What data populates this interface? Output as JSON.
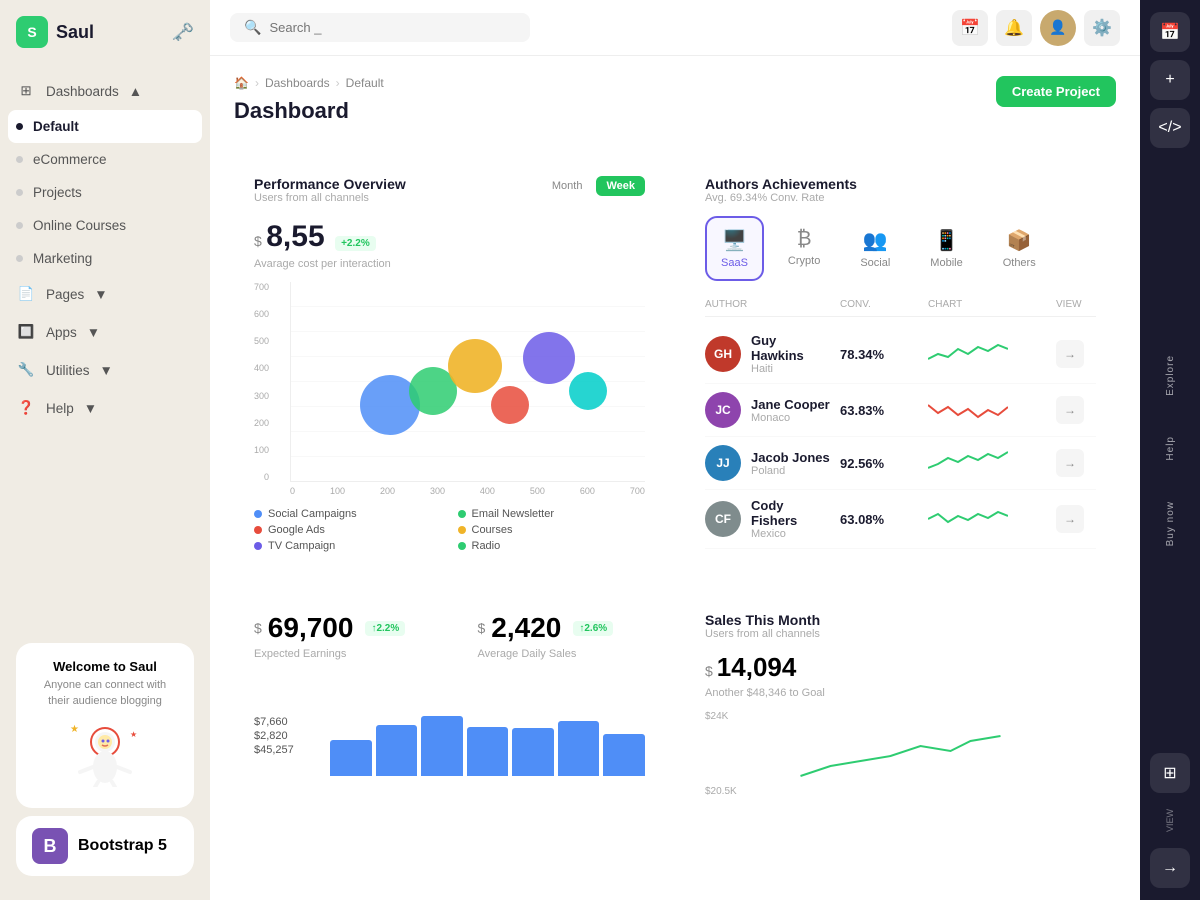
{
  "app": {
    "name": "Saul",
    "logo_letter": "S"
  },
  "topbar": {
    "search_placeholder": "Search _",
    "create_button": "Create Project"
  },
  "sidebar": {
    "nav_items": [
      {
        "id": "dashboards",
        "label": "Dashboards",
        "type": "section",
        "has_chevron": true,
        "icon": "grid"
      },
      {
        "id": "default",
        "label": "Default",
        "type": "sub",
        "active": true
      },
      {
        "id": "ecommerce",
        "label": "eCommerce",
        "type": "sub"
      },
      {
        "id": "projects",
        "label": "Projects",
        "type": "sub"
      },
      {
        "id": "online-courses",
        "label": "Online Courses",
        "type": "sub"
      },
      {
        "id": "marketing",
        "label": "Marketing",
        "type": "sub"
      },
      {
        "id": "pages",
        "label": "Pages",
        "type": "section",
        "has_chevron": true,
        "icon": "file"
      },
      {
        "id": "apps",
        "label": "Apps",
        "type": "section",
        "has_chevron": true,
        "icon": "apps"
      },
      {
        "id": "utilities",
        "label": "Utilities",
        "type": "section",
        "has_chevron": true,
        "icon": "tool"
      },
      {
        "id": "help",
        "label": "Help",
        "type": "section",
        "has_chevron": true,
        "icon": "help"
      }
    ],
    "welcome": {
      "title": "Welcome to Saul",
      "subtitle": "Anyone can connect with their audience blogging"
    }
  },
  "breadcrumb": {
    "home": "🏠",
    "dashboards": "Dashboards",
    "current": "Default"
  },
  "page_title": "Dashboard",
  "performance": {
    "title": "Performance Overview",
    "subtitle": "Users from all channels",
    "tabs": [
      "Month",
      "Week"
    ],
    "active_tab": "Month",
    "metric": "8,55",
    "metric_currency": "$",
    "metric_change": "+2.2%",
    "metric_label": "Avarage cost per interaction",
    "y_axis": [
      "700",
      "600",
      "500",
      "400",
      "300",
      "200",
      "100",
      "0"
    ],
    "x_axis": [
      "0",
      "100",
      "200",
      "300",
      "400",
      "500",
      "600",
      "700"
    ],
    "bubbles": [
      {
        "x": 28,
        "y": 62,
        "size": 60,
        "color": "#4f8ef7"
      },
      {
        "x": 40,
        "y": 55,
        "size": 48,
        "color": "#2ecc71"
      },
      {
        "x": 52,
        "y": 45,
        "size": 54,
        "color": "#f0b429"
      },
      {
        "x": 62,
        "y": 62,
        "size": 38,
        "color": "#e74c3c"
      },
      {
        "x": 73,
        "y": 52,
        "size": 50,
        "color": "#6c5ce7"
      },
      {
        "x": 83,
        "y": 58,
        "size": 38,
        "color": "#00cec9"
      }
    ],
    "legend": [
      {
        "label": "Social Campaigns",
        "color": "#4f8ef7"
      },
      {
        "label": "Email Newsletter",
        "color": "#2ecc71"
      },
      {
        "label": "Google Ads",
        "color": "#e74c3c"
      },
      {
        "label": "Courses",
        "color": "#f0b429"
      },
      {
        "label": "TV Campaign",
        "color": "#6c5ce7"
      },
      {
        "label": "Radio",
        "color": "#2ecc71"
      }
    ]
  },
  "authors": {
    "title": "Authors Achievements",
    "subtitle": "Avg. 69.34% Conv. Rate",
    "categories": [
      {
        "id": "saas",
        "label": "SaaS",
        "icon": "🖥️",
        "active": true
      },
      {
        "id": "crypto",
        "label": "Crypto",
        "icon": "₿"
      },
      {
        "id": "social",
        "label": "Social",
        "icon": "👥"
      },
      {
        "id": "mobile",
        "label": "Mobile",
        "icon": "📱"
      },
      {
        "id": "others",
        "label": "Others",
        "icon": "📦"
      }
    ],
    "table_headers": [
      "AUTHOR",
      "CONV.",
      "CHART",
      "VIEW"
    ],
    "rows": [
      {
        "name": "Guy Hawkins",
        "country": "Haiti",
        "conv": "78.34%",
        "sparkline_color": "#2ecc71",
        "avatar_bg": "#c0392b"
      },
      {
        "name": "Jane Cooper",
        "country": "Monaco",
        "conv": "63.83%",
        "sparkline_color": "#e74c3c",
        "avatar_bg": "#8e44ad"
      },
      {
        "name": "Jacob Jones",
        "country": "Poland",
        "conv": "92.56%",
        "sparkline_color": "#2ecc71",
        "avatar_bg": "#2980b9"
      },
      {
        "name": "Cody Fishers",
        "country": "Mexico",
        "conv": "63.08%",
        "sparkline_color": "#2ecc71",
        "avatar_bg": "#7f8c8d"
      }
    ]
  },
  "stats": {
    "earnings": {
      "value": "69,700",
      "currency": "$",
      "change": "+2.2%",
      "label": "Expected Earnings"
    },
    "daily_sales": {
      "value": "2,420",
      "currency": "$",
      "change": "+2.6%",
      "label": "Average Daily Sales"
    },
    "bar_values": [
      440,
      620,
      700,
      590,
      580,
      680,
      500
    ],
    "sales_this_month": {
      "title": "Sales This Month",
      "subtitle": "Users from all channels",
      "value": "14,094",
      "currency": "$",
      "goal": "Another $48,346 to Goal",
      "y_labels": [
        "$24K",
        "$20.5K"
      ]
    },
    "side_values": [
      "$7,660",
      "$2,820",
      "$45,257"
    ]
  },
  "right_sidebar": {
    "sections": [
      {
        "label": "Explore",
        "icon": "⊞"
      },
      {
        "label": "Help",
        "icon": "?"
      },
      {
        "label": "Buy now",
        "icon": "↗"
      }
    ]
  },
  "bootstrap": {
    "label": "Bootstrap 5",
    "icon": "B"
  }
}
